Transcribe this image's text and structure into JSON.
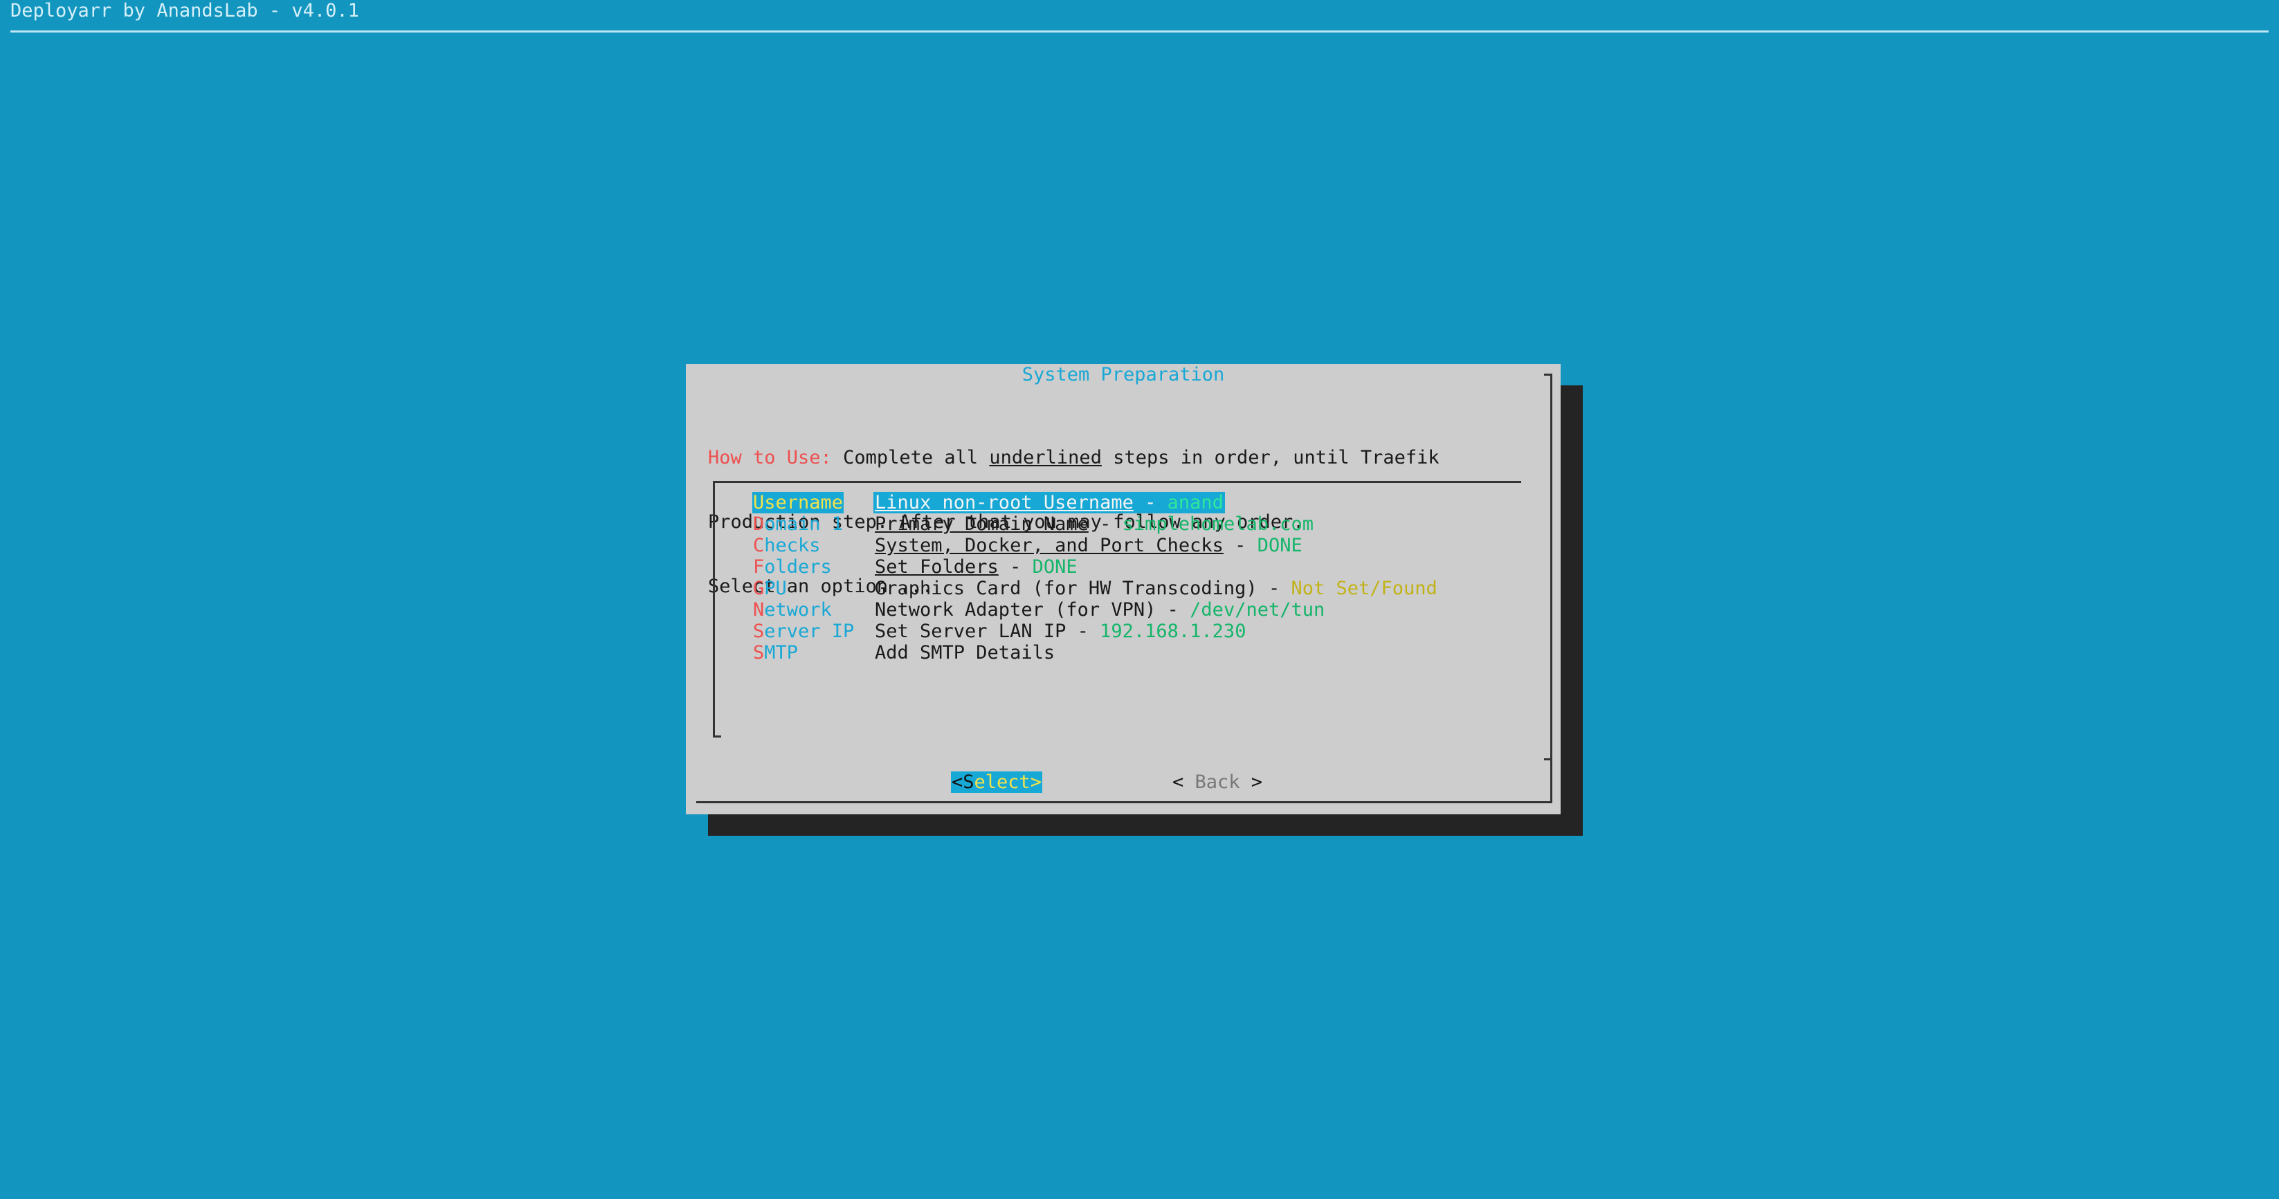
{
  "app": {
    "title": "Deployarr by AnandsLab - v4.0.1"
  },
  "dialog": {
    "title": "System Preparation",
    "intro_label": "How to Use:",
    "intro_line1_a": " Complete all ",
    "intro_line1_ul": "underlined",
    "intro_line1_b": " steps in order, until Traefik",
    "intro_line2": "Production step. After that you may follow any order.",
    "intro_line3": "Select an option ..."
  },
  "menu": {
    "items": [
      {
        "hot": "U",
        "rest": "sername",
        "desc_ul": "Linux non-root Username",
        "desc_plain": "",
        "sep": " - ",
        "value": "anand",
        "value_color": "green",
        "selected": true
      },
      {
        "hot": "D",
        "rest": "omain 1",
        "desc_ul": "Primary Domain Name",
        "desc_plain": "",
        "sep": " - ",
        "value": "simplehomelab.com",
        "value_color": "green",
        "selected": false
      },
      {
        "hot": "C",
        "rest": "hecks",
        "desc_ul": "System, Docker, and Port Checks",
        "desc_plain": "",
        "sep": " - ",
        "value": "DONE",
        "value_color": "green",
        "selected": false
      },
      {
        "hot": "F",
        "rest": "olders",
        "desc_ul": "Set Folders",
        "desc_plain": "",
        "sep": " - ",
        "value": "DONE",
        "value_color": "green",
        "selected": false
      },
      {
        "hot": "G",
        "rest": "PU",
        "desc_ul": "",
        "desc_plain": "Graphics Card (for HW Transcoding)",
        "sep": " - ",
        "value": "Not Set/Found",
        "value_color": "yellow",
        "selected": false
      },
      {
        "hot": "N",
        "rest": "etwork",
        "desc_ul": "",
        "desc_plain": "Network Adapter (for VPN)",
        "sep": " - ",
        "value": "/dev/net/tun",
        "value_color": "green",
        "selected": false
      },
      {
        "hot": "S",
        "rest": "erver IP",
        "desc_ul": "",
        "desc_plain": "Set Server LAN IP",
        "sep": " - ",
        "value": "192.168.1.230",
        "value_color": "green",
        "selected": false
      },
      {
        "hot": "S",
        "rest": "MTP",
        "desc_ul": "",
        "desc_plain": "Add SMTP Details",
        "sep": "",
        "value": "",
        "value_color": "green",
        "selected": false
      }
    ]
  },
  "buttons": {
    "select_open": "<",
    "select_first": "S",
    "select_rest": "elect>",
    "back_open": "< ",
    "back_label": "Back",
    "back_close": " >"
  },
  "colors": {
    "background": "#1296c0",
    "dialog": "#cdcdcd",
    "accent": "#18a8d6",
    "hotkey": "#ee5050",
    "value_green": "#15b56a",
    "value_yellow": "#c2b21a",
    "highlight_text": "#f2e24a"
  }
}
